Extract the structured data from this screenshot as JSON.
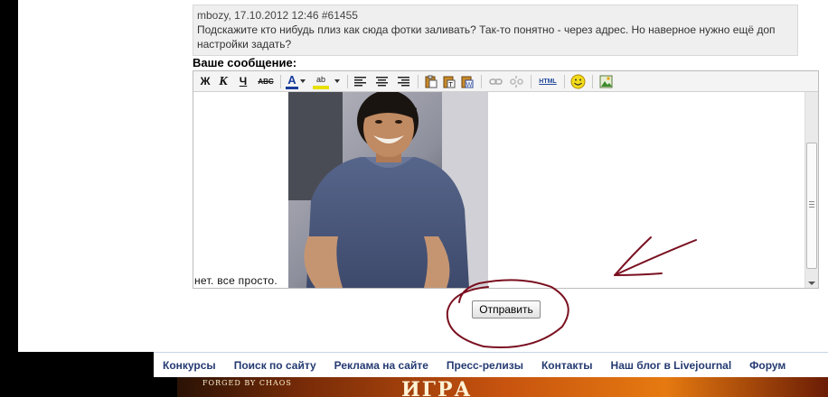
{
  "quote": {
    "meta": "mbozy, 17.10.2012 12:46 #61455",
    "text": "Подскажите кто нибудь плиз как сюда фотки заливать? Так-то понятно - через адрес. Но наверное нужно ещё доп настройки задать?"
  },
  "editor": {
    "label": "Ваше сообщение:",
    "toolbar": {
      "bold": "Ж",
      "italic": "К",
      "underline": "Ч",
      "strike": "ABC",
      "html": "HTML",
      "font_color_icon": "A",
      "highlight_icon": "ab"
    },
    "body_text": "нет. все просто."
  },
  "submit_label": "Отправить",
  "nav": {
    "items": [
      "Конкурсы",
      "Поиск по сайту",
      "Реклама на сайте",
      "Пресс-релизы",
      "Контакты",
      "Наш блог в Livejournal",
      "Форум"
    ]
  },
  "banner": {
    "tagline": "FORGED BY CHAOS",
    "title": "ИГРА"
  },
  "colors": {
    "nav_link": "#243a72",
    "annotation": "#7a1020",
    "quote_bg": "#efefef"
  },
  "icons": [
    "bold-icon",
    "italic-icon",
    "underline-icon",
    "strikethrough-icon",
    "font-color-icon",
    "highlight-icon",
    "align-left-icon",
    "align-center-icon",
    "align-right-icon",
    "paste-icon",
    "paste-text-icon",
    "paste-word-icon",
    "link-icon",
    "unlink-icon",
    "html-icon",
    "smiley-icon",
    "image-icon"
  ]
}
